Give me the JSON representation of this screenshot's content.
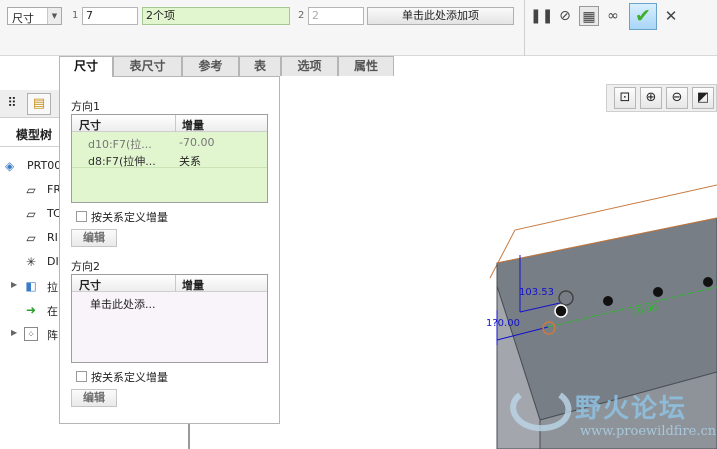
{
  "dashboard": {
    "mode_select": "尺寸",
    "dir1_index": "1",
    "dir1_value": "7",
    "dir1_refs": "2个项",
    "dir2_index": "2",
    "dir2_value": "2",
    "dir2_add": "单击此处添加项"
  },
  "tabs": [
    {
      "label": "尺寸"
    },
    {
      "label": "表尺寸"
    },
    {
      "label": "参考"
    },
    {
      "label": "表"
    },
    {
      "label": "选项"
    },
    {
      "label": "属性"
    }
  ],
  "panel": {
    "direction1": {
      "label": "方向1",
      "col_dim": "尺寸",
      "col_inc": "增量",
      "rows": [
        {
          "dim": "d10:F7(拉...",
          "inc": "-70.00"
        },
        {
          "dim": "d8:F7(拉伸...",
          "inc": "关系"
        }
      ],
      "checkbox_label": "按关系定义增量",
      "edit_label": "编辑"
    },
    "direction2": {
      "label": "方向2",
      "col_dim": "尺寸",
      "col_inc": "增量",
      "placeholder_row": "单击此处添...",
      "checkbox_label": "按关系定义增量",
      "edit_label": "编辑"
    }
  },
  "tree": {
    "title": "模型树",
    "items": [
      {
        "label": "PRT00",
        "icon": "part-icon"
      },
      {
        "label": "FR",
        "icon": "plane-icon"
      },
      {
        "label": "TC",
        "icon": "plane-icon"
      },
      {
        "label": "RI",
        "icon": "plane-icon"
      },
      {
        "label": "DI",
        "icon": "csys-icon"
      },
      {
        "label": "拉",
        "icon": "extrude-icon"
      },
      {
        "label": "在",
        "icon": "insert-arrow-icon"
      },
      {
        "label": "阵",
        "icon": "pattern-icon"
      }
    ]
  },
  "graphics": {
    "dim1": "103.53",
    "dim2": "1?0.00",
    "green_dim": "70.00"
  },
  "watermark": {
    "text": "野火论坛",
    "url": "www.proewildfire.cn"
  },
  "colors": {
    "accept_green": "#3fae2a",
    "ref_highlight": "#e1f5cf",
    "dim_blue": "#1414c8"
  }
}
